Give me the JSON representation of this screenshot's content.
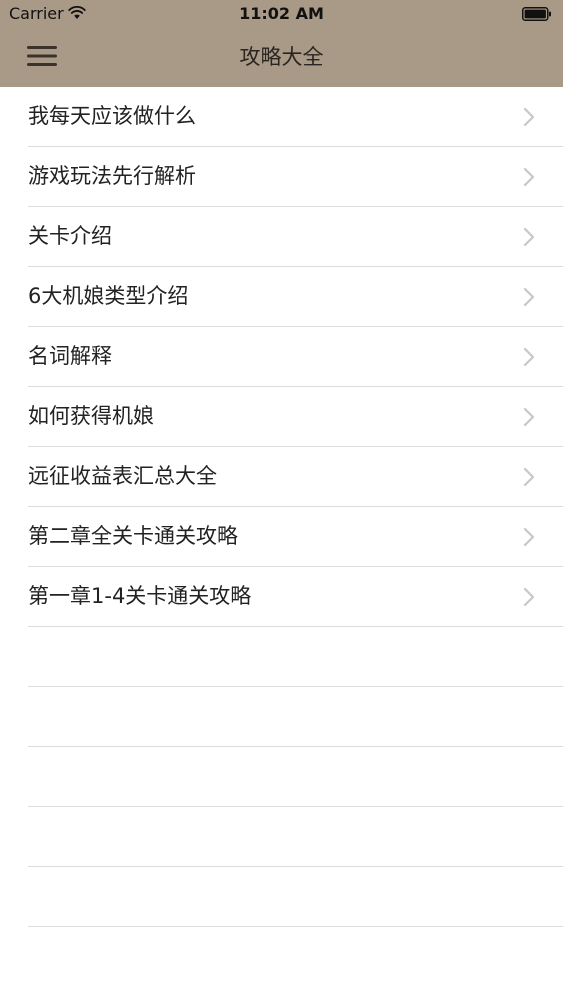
{
  "status_bar": {
    "carrier": "Carrier",
    "time": "11:02 AM"
  },
  "nav": {
    "title": "攻略大全"
  },
  "icons": {
    "menu": "hamburger-menu-icon",
    "wifi": "wifi-icon",
    "battery": "battery-icon",
    "chevron": "chevron-right-icon"
  },
  "colors": {
    "header_bg": "#a99a87",
    "separator": "#dcdcdc",
    "chevron": "#c7c7cc"
  },
  "list": {
    "items": [
      {
        "label": "我每天应该做什么"
      },
      {
        "label": "游戏玩法先行解析"
      },
      {
        "label": "关卡介绍"
      },
      {
        "label": "6大机娘类型介绍"
      },
      {
        "label": "名词解释"
      },
      {
        "label": "如何获得机娘"
      },
      {
        "label": "远征收益表汇总大全"
      },
      {
        "label": "第二章全关卡通关攻略"
      },
      {
        "label": "第一章1-4关卡通关攻略"
      }
    ]
  }
}
